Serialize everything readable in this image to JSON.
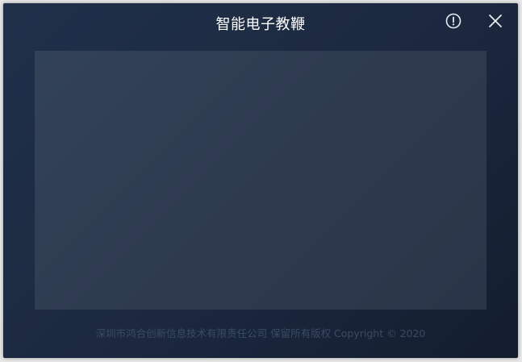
{
  "window": {
    "title": "智能电子教鞭"
  },
  "titlebar": {
    "info_icon": "info-circle-icon",
    "close_icon": "close-x-icon"
  },
  "footer": {
    "copyright": "深圳市鸿合创新信息技术有限责任公司 保留所有版权 Copyright © 2020"
  },
  "colors": {
    "window_bg": "#1c2940",
    "panel_bg": "#2e3b4f",
    "title_text": "#ffffff",
    "footer_text": "#3b4b63",
    "icon": "#e8ecf2"
  }
}
